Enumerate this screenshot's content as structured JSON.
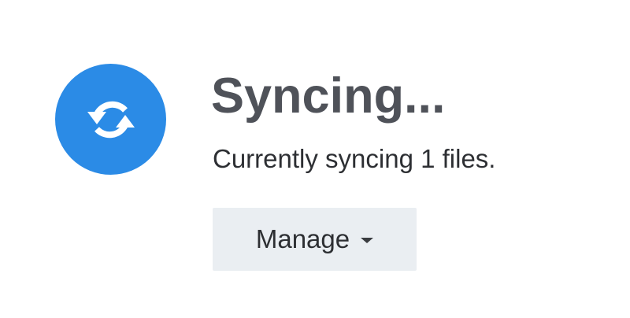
{
  "status": {
    "icon": "sync-icon",
    "icon_color": "#2b8be6",
    "title": "Syncing...",
    "message": "Currently syncing 1 files."
  },
  "actions": {
    "manage_label": "Manage",
    "manage_icon": "chevron-down-icon"
  }
}
